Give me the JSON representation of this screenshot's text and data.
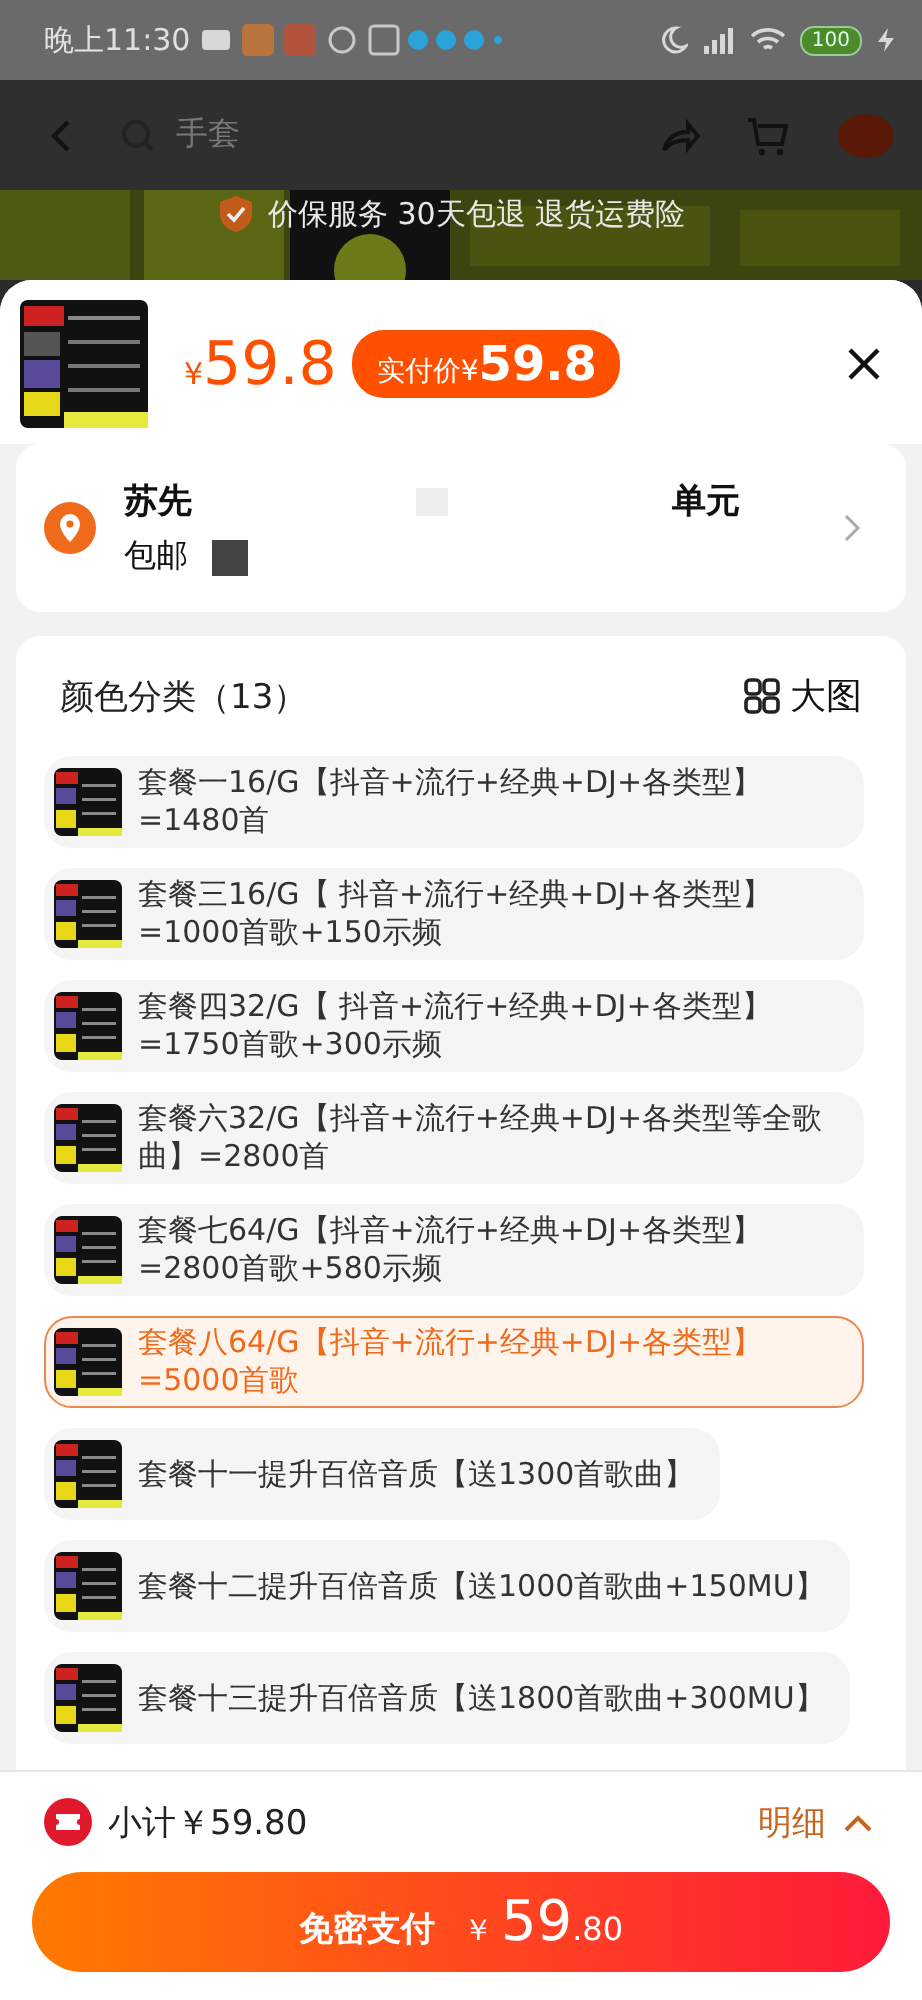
{
  "status_bar": {
    "time": "晚上11:30",
    "battery": "100"
  },
  "nav": {
    "search_placeholder": "手套"
  },
  "banner": {
    "text": "价保服务 30天包退 退货运费险"
  },
  "product": {
    "price_currency": "¥",
    "price": "59.8",
    "badge_label": "实付价",
    "badge_currency": "¥",
    "badge_price": "59.8"
  },
  "address": {
    "name": "苏先",
    "tail": "单元",
    "shipping": "包邮"
  },
  "options": {
    "title": "颜色分类（13）",
    "view_large": "大图",
    "items": [
      {
        "label": "套餐一16/G【抖音+流行+经典+DJ+各类型】=1480首",
        "selected": false
      },
      {
        "label": "套餐三16/G【 抖音+流行+经典+DJ+各类型】=1000首歌+150示频",
        "selected": false
      },
      {
        "label": "套餐四32/G【 抖音+流行+经典+DJ+各类型】=1750首歌+300示频",
        "selected": false
      },
      {
        "label": "套餐六32/G【抖音+流行+经典+DJ+各类型等全歌曲】=2800首",
        "selected": false
      },
      {
        "label": "套餐七64/G【抖音+流行+经典+DJ+各类型】=2800首歌+580示频",
        "selected": false
      },
      {
        "label": "套餐八64/G【抖音+流行+经典+DJ+各类型】=5000首歌",
        "selected": true
      },
      {
        "label": "套餐十一提升百倍音质【送1300首歌曲】",
        "selected": false
      },
      {
        "label": "套餐十二提升百倍音质【送1000首歌曲+150MU】",
        "selected": false
      },
      {
        "label": "套餐十三提升百倍音质【送1800首歌曲+300MU】",
        "selected": false
      }
    ]
  },
  "footer": {
    "subtotal": "小计￥59.80",
    "details": "明细",
    "pay_label": "免密支付",
    "pay_currency": "￥",
    "pay_integer": "59",
    "pay_decimal": ".80"
  }
}
